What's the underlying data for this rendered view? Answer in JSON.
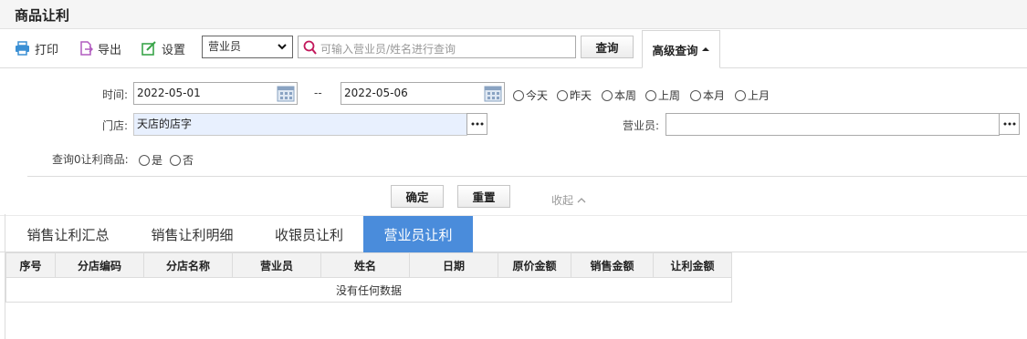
{
  "page": {
    "title": "商品让利"
  },
  "toolbar": {
    "print_label": "打印",
    "export_label": "导出",
    "settings_label": "设置",
    "field_select": "营业员",
    "search_placeholder": "可输入营业员/姓名进行查询",
    "query_label": "查询",
    "advanced_label": "高级查询"
  },
  "filters": {
    "time_label": "时间:",
    "date_from": "2022-05-01",
    "date_sep": "--",
    "date_to": "2022-05-06",
    "quick_ranges": [
      "今天",
      "昨天",
      "本周",
      "上周",
      "本月",
      "上月"
    ],
    "store_label": "门店:",
    "store_value": "天店的店字",
    "clerk_label": "营业员:",
    "clerk_value": "",
    "zero_label": "查询0让利商品:",
    "yes_label": "是",
    "no_label": "否",
    "confirm_label": "确定",
    "reset_label": "重置",
    "collapse_label": "收起"
  },
  "tabs": [
    "销售让利汇总",
    "销售让利明细",
    "收银员让利",
    "营业员让利"
  ],
  "active_tab": 3,
  "table": {
    "columns": [
      "序号",
      "分店编码",
      "分店名称",
      "营业员",
      "姓名",
      "日期",
      "原价金额",
      "销售金额",
      "让利金额"
    ],
    "empty_text": "没有任何数据"
  },
  "colors": {
    "accent": "#4a8cdb",
    "icon_blue": "#3a8fd4",
    "icon_purple": "#b15bbf",
    "icon_green": "#3aa54a",
    "search_icon": "#c2185b"
  }
}
